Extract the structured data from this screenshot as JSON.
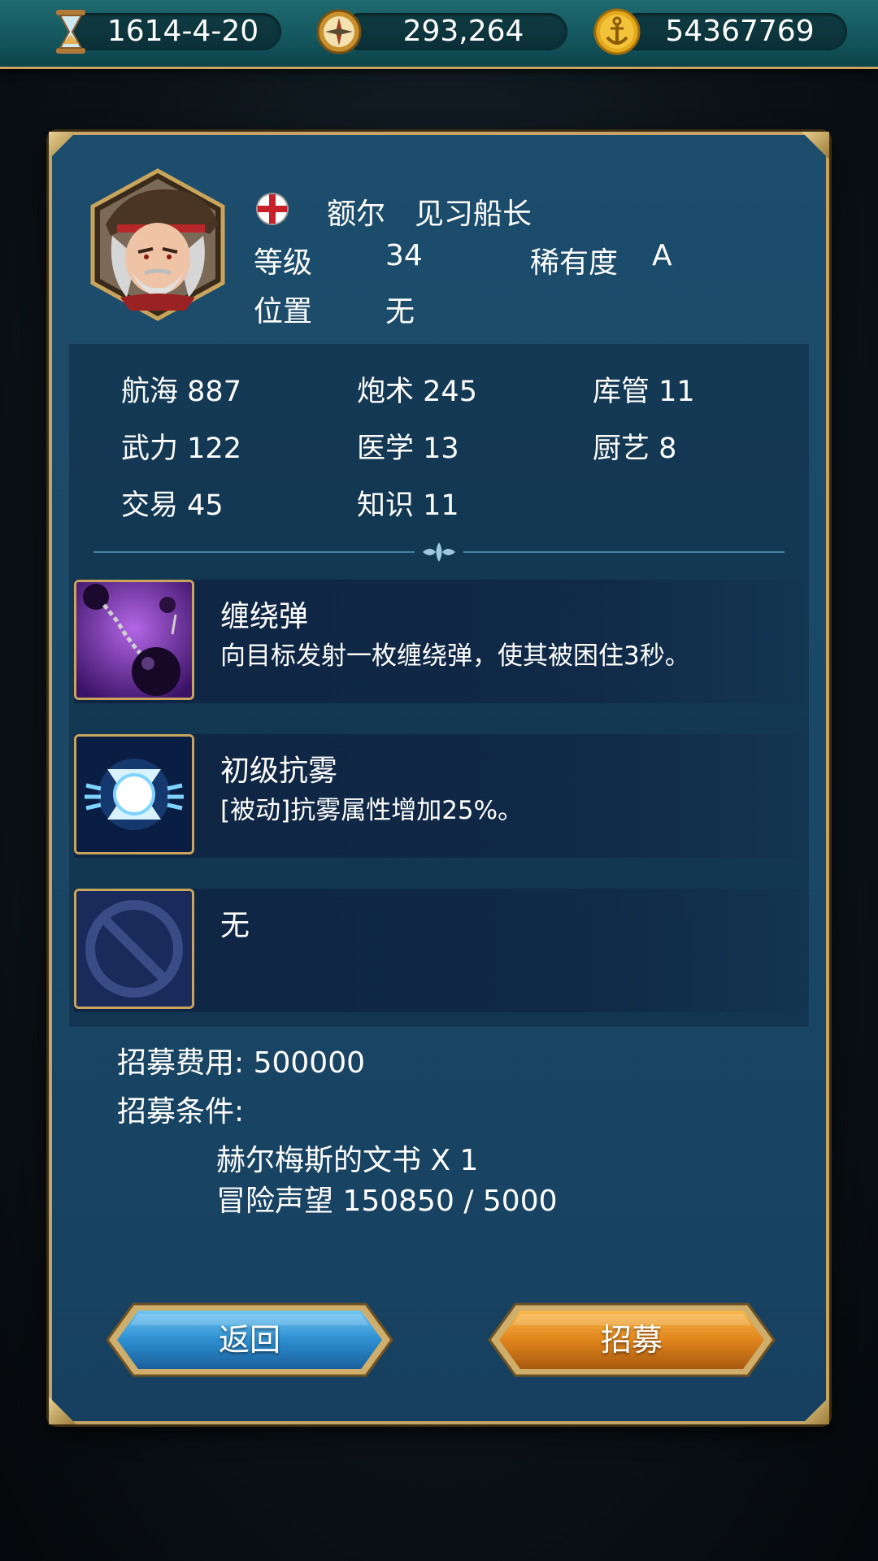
{
  "resources": {
    "date": "1614-4-20",
    "compass_value": "293,264",
    "gold": "54367769",
    "icons": [
      "hourglass-icon",
      "compass-icon",
      "anchor-coin-icon"
    ]
  },
  "captain": {
    "name": "额尔",
    "title": "见习船长",
    "flag": "england",
    "level_label": "等级",
    "level": "34",
    "rarity_label": "稀有度",
    "rarity": "A",
    "position_label": "位置",
    "position": "无"
  },
  "stats": [
    {
      "label": "航海",
      "value": "887"
    },
    {
      "label": "炮术",
      "value": "245"
    },
    {
      "label": "库管",
      "value": "11"
    },
    {
      "label": "武力",
      "value": "122"
    },
    {
      "label": "医学",
      "value": "13"
    },
    {
      "label": "厨艺",
      "value": "8"
    },
    {
      "label": "交易",
      "value": "45"
    },
    {
      "label": "知识",
      "value": "11"
    }
  ],
  "skills": [
    {
      "name": "缠绕弹",
      "desc": "向目标发射一枚缠绕弹，使其被困住3秒。",
      "icon": "chain-shot-icon"
    },
    {
      "name": "初级抗雾",
      "desc": "[被动]抗雾属性增加25%。",
      "icon": "fog-resist-icon"
    },
    {
      "name": "无",
      "desc": "",
      "icon": "empty-slot-icon"
    }
  ],
  "recruit": {
    "cost_label": "招募费用:",
    "cost": "500000",
    "conditions_label": "招募条件:",
    "conditions": [
      "赫尔梅斯的文书 X 1",
      "冒险声望 150850 / 5000"
    ]
  },
  "buttons": {
    "back": "返回",
    "recruit": "招募"
  },
  "colors": {
    "panel": "#1a4866",
    "gold_border": "#c6a466",
    "back_button": "#2d8fd0",
    "recruit_button": "#e0851c"
  }
}
